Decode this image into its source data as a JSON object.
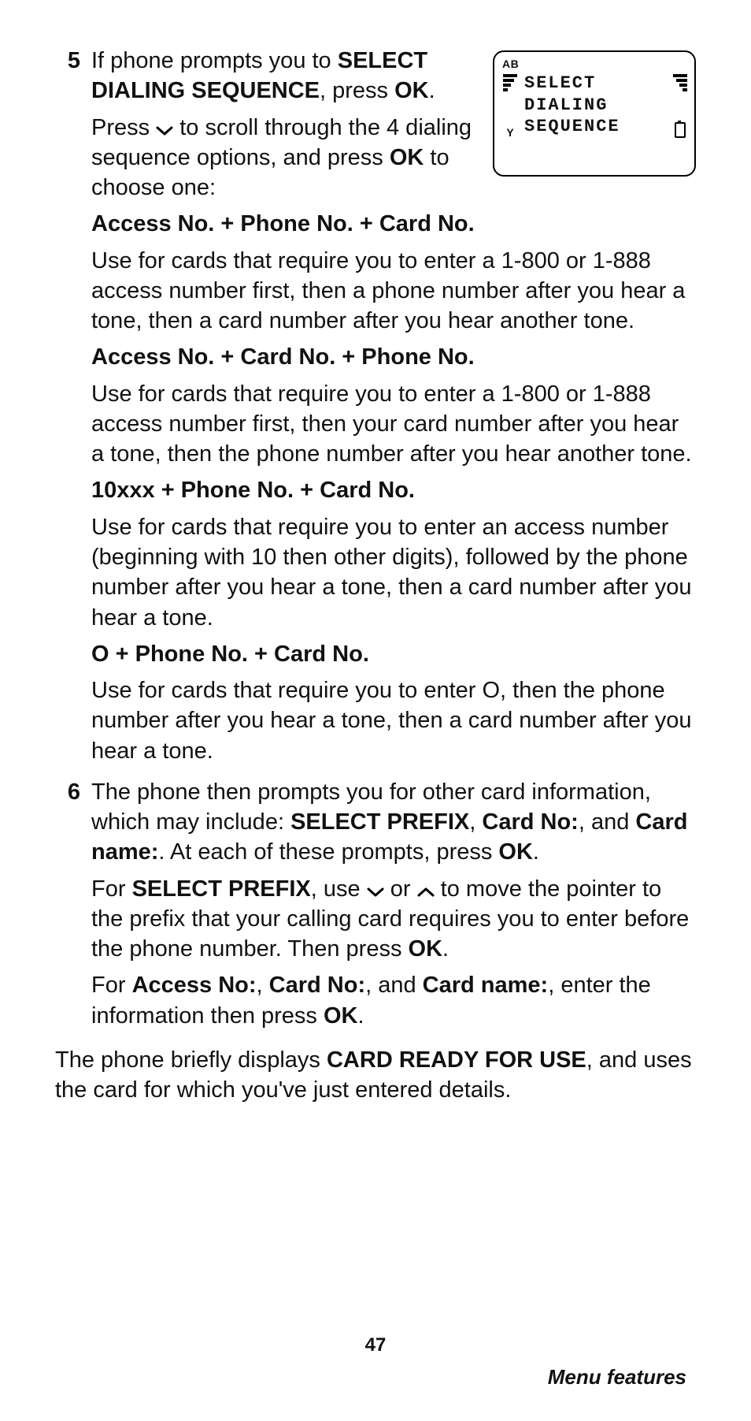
{
  "page_number": "47",
  "footer": "Menu features",
  "screen": {
    "ab": "AB",
    "line1": "SELECT",
    "line2": "DIALING",
    "line3": "SEQUENCE"
  },
  "step5": {
    "num": "5",
    "p1_a": "If phone prompts you to ",
    "p1_b": "SELECT DIALING SEQUENCE",
    "p1_c": ", press ",
    "p1_d": "OK",
    "p1_e": ".",
    "p2_a": "Press ",
    "p2_b": " to scroll through the 4 dialing sequence options, and press ",
    "p2_c": "OK",
    "p2_d": " to choose one:",
    "opt1_title": "Access No. + Phone No. + Card No.",
    "opt1_body": "Use for cards that require you to enter a 1-800 or 1-888 access number first, then a phone number after you hear a tone, then a card number after you hear another tone.",
    "opt2_title": "Access No. + Card No. + Phone No.",
    "opt2_body": "Use for cards that require you to enter a 1-800 or 1-888 access number first, then your card number after you hear a tone, then the phone number after you hear another tone.",
    "opt3_title": "10xxx + Phone No. + Card No.",
    "opt3_body": "Use for cards that require you to enter an access number (beginning with 10 then other digits), followed by the phone number after you hear a tone, then a card number after you hear a tone.",
    "opt4_title": "O + Phone No. + Card No.",
    "opt4_body": "Use for cards that require you to enter O, then the phone number after you hear a tone, then a card number after you hear a tone."
  },
  "step6": {
    "num": "6",
    "p1_a": "The phone then prompts you for other card information, which may include: ",
    "p1_b": "SELECT PREFIX",
    "p1_c": ", ",
    "p1_d": "Card No:",
    "p1_e": ", and ",
    "p1_f": "Card name:",
    "p1_g": ". At each of these prompts, press ",
    "p1_h": "OK",
    "p1_i": ".",
    "p2_a": "For ",
    "p2_b": "SELECT PREFIX",
    "p2_c": ", use ",
    "p2_d": " or ",
    "p2_e": " to move the pointer to the prefix that your calling card requires you to enter before the phone number. Then press ",
    "p2_f": "OK",
    "p2_g": ".",
    "p3_a": "For ",
    "p3_b": "Access No:",
    "p3_c": ", ",
    "p3_d": "Card No:",
    "p3_e": ", and ",
    "p3_f": "Card name:",
    "p3_g": ", enter the information then press ",
    "p3_h": "OK",
    "p3_i": "."
  },
  "final": {
    "a": "The phone briefly displays ",
    "b": "CARD READY FOR USE",
    "c": ", and uses the card for which you've just entered details."
  }
}
